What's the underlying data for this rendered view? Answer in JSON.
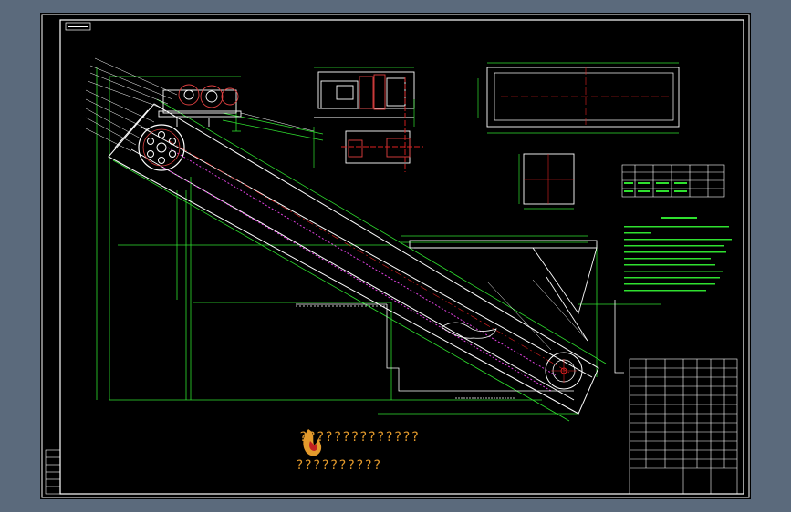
{
  "colors": {
    "page_background": "#5b6a7c",
    "drawing_background": "#000000",
    "outline_white": "#ffffff",
    "dimension_green": "#2fe02f",
    "centerline_red": "#e02020",
    "gear_red": "#e04040",
    "chain_magenta": "#e040e0",
    "watermark_orange": "#e39a2c"
  },
  "watermark": {
    "line1": "??????????????",
    "line2": "??????????"
  },
  "icons": {
    "logo": "flame-logo-icon"
  }
}
